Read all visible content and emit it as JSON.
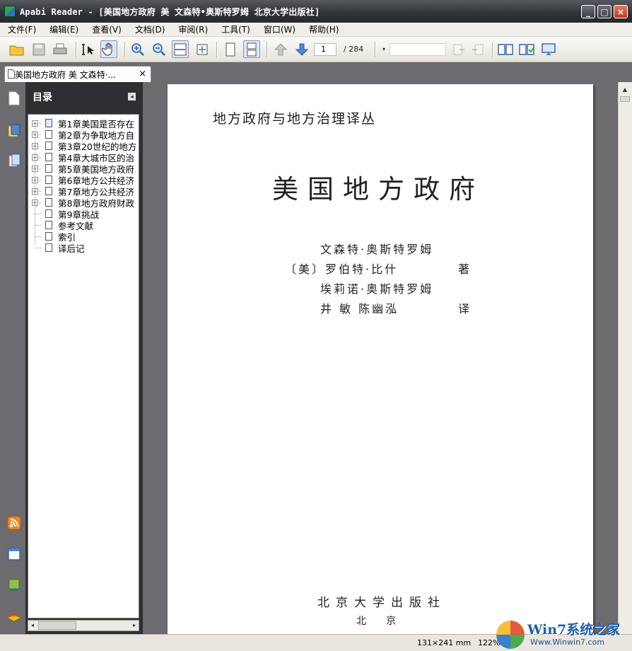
{
  "window": {
    "title": "Apabi Reader - [美国地方政府 美 文森特•奥斯特罗姆 北京大学出版社]",
    "minimize": "_",
    "maximize": "□",
    "close": "×"
  },
  "menu": [
    "文件(F)",
    "编辑(E)",
    "查看(V)",
    "文档(D)",
    "审阅(R)",
    "工具(T)",
    "窗口(W)",
    "帮助(H)"
  ],
  "toolbar": {
    "current_page": "1",
    "total_pages": "/ 284",
    "icons": [
      "open-folder-icon",
      "save-icon",
      "print-icon",
      "select-text-icon",
      "hand-tool-icon",
      "zoom-in-icon",
      "zoom-out-icon",
      "fit-width-icon",
      "fit-page-icon",
      "single-page-icon",
      "continuous-page-icon",
      "previous-page-icon",
      "next-page-icon",
      "search-dropdown-icon",
      "find-next-icon",
      "find-previous-icon",
      "book-view-icon",
      "bookmark-icon",
      "screen-icon"
    ]
  },
  "tab": {
    "title": "美国地方政府 美 文森特·...",
    "close": "×"
  },
  "toc": {
    "header": "目录",
    "collapse": "◂",
    "items": [
      {
        "label": "第1章美国是否存在",
        "expandable": true,
        "active": true
      },
      {
        "label": "第2章为争取地方自",
        "expandable": true
      },
      {
        "label": "第3章20世纪的地方",
        "expandable": true
      },
      {
        "label": "第4章大城市区的治",
        "expandable": true
      },
      {
        "label": "第5章美国地方政府",
        "expandable": true
      },
      {
        "label": "第6章地方公共经济",
        "expandable": true
      },
      {
        "label": "第7章地方公共经济",
        "expandable": true
      },
      {
        "label": "第8章地方政府财政",
        "expandable": true
      },
      {
        "label": "第9章挑战",
        "expandable": false
      },
      {
        "label": "参考文献",
        "expandable": false
      },
      {
        "label": "索引",
        "expandable": false
      },
      {
        "label": "译后记",
        "expandable": false
      }
    ],
    "scroll_left": "◂",
    "scroll_right": "▸"
  },
  "page": {
    "series_title": "地方政府与地方治理译丛",
    "book_title": "美国地方政府",
    "credits": [
      "文森特·奥斯特罗姆",
      "〔美〕罗伯特·比什",
      "埃莉诺·奥斯特罗姆",
      "井  敏  陈幽泓"
    ],
    "role_author": "著",
    "role_translator": "译",
    "publisher": "北京大学出版社",
    "city": "北京"
  },
  "status": {
    "page_size": "131×241 mm",
    "zoom": "122%"
  },
  "watermark": {
    "text": "Win7系统之家",
    "url": "Www.Winwin7.com"
  }
}
